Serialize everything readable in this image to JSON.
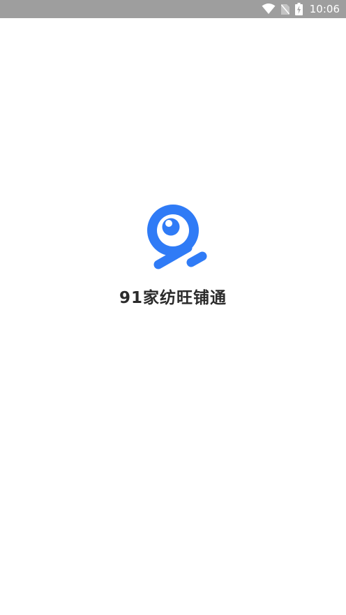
{
  "status_bar": {
    "time": "10:06",
    "icons": [
      "wifi-icon",
      "no-sim-icon",
      "battery-charging-icon"
    ]
  },
  "splash": {
    "app_name": "91家纺旺铺通",
    "logo_icon": "app-logo-icon",
    "brand_color": "#2f7bf6"
  }
}
